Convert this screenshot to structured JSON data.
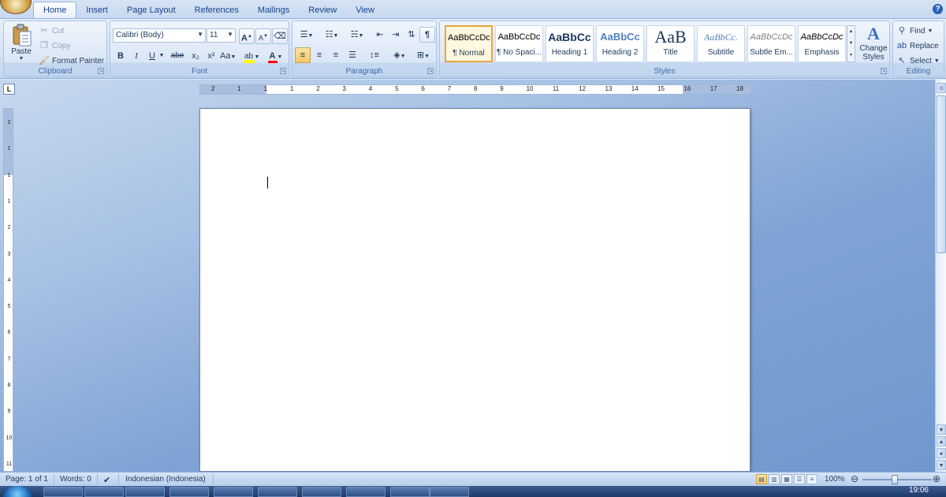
{
  "tabs": [
    "Home",
    "Insert",
    "Page Layout",
    "References",
    "Mailings",
    "Review",
    "View"
  ],
  "clipboard": {
    "label": "Clipboard",
    "paste": "Paste",
    "cut": "Cut",
    "copy": "Copy",
    "format_painter": "Format Painter"
  },
  "font": {
    "label": "Font",
    "font_name": "Calibri (Body)",
    "font_size": "11",
    "bold": "B",
    "italic": "I",
    "underline": "U",
    "strike": "abe",
    "subscript": "x₂",
    "superscript": "x²",
    "change_case": "Aa",
    "grow": "A",
    "shrink": "A"
  },
  "paragraph": {
    "label": "Paragraph"
  },
  "styles": {
    "label": "Styles",
    "items": [
      {
        "sample": "AaBbCcDc",
        "name": "¶ Normal"
      },
      {
        "sample": "AaBbCcDc",
        "name": "¶ No Spaci..."
      },
      {
        "sample": "AaBbCc",
        "name": "Heading 1"
      },
      {
        "sample": "AaBbCc",
        "name": "Heading 2"
      },
      {
        "sample": "AaB",
        "name": "Title"
      },
      {
        "sample": "AaBbCc.",
        "name": "Subtitle"
      },
      {
        "sample": "AaBbCcDc",
        "name": "Subtle Em..."
      },
      {
        "sample": "AaBbCcDc",
        "name": "Emphasis"
      }
    ],
    "change_styles": "Change Styles"
  },
  "editing": {
    "label": "Editing",
    "find": "Find",
    "replace": "Replace",
    "select": "Select"
  },
  "ruler_marks": [
    "2",
    "1",
    "1",
    "1",
    "2",
    "3",
    "4",
    "5",
    "6",
    "7",
    "8",
    "9",
    "10",
    "11",
    "12",
    "13",
    "14",
    "15",
    "16",
    "17",
    "18"
  ],
  "vruler_marks": [
    "2",
    "1",
    "1",
    "1",
    "2",
    "3",
    "4",
    "5",
    "6",
    "7",
    "8",
    "9",
    "10",
    "11"
  ],
  "status": {
    "page": "Page: 1 of 1",
    "words": "Words: 0",
    "language": "Indonesian (Indonesia)",
    "zoom": "100%"
  },
  "taskbar": {
    "clock": "19:06"
  },
  "colors": {
    "accent": "#15428b",
    "selected_style": "#e9a53a",
    "highlight": "#ffff00",
    "font_color": "#ff0000"
  }
}
